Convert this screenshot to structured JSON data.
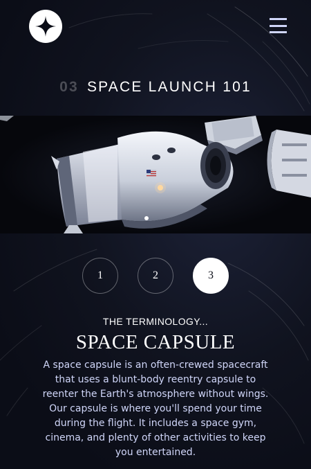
{
  "header": {
    "logo_icon": "star-logo-icon",
    "menu_icon": "hamburger-menu-icon"
  },
  "section": {
    "number": "03",
    "title": "SPACE LAUNCH 101"
  },
  "hero": {
    "image": "space-capsule-photo"
  },
  "steps": [
    {
      "label": "1",
      "active": false
    },
    {
      "label": "2",
      "active": false
    },
    {
      "label": "3",
      "active": true
    }
  ],
  "content": {
    "eyebrow": "THE TERMINOLOGY...",
    "term": "SPACE CAPSULE",
    "description": "A space capsule is an often-crewed spacecraft that uses a blunt-body reentry capsule to reenter the Earth's atmosphere without wings. Our capsule is where you'll spend your time during the flight. It includes a space gym, cinema, and plenty of other activities to keep you entertained."
  },
  "colors": {
    "background": "#0b0d17",
    "text": "#ffffff",
    "muted_text": "#d0d6f9"
  }
}
